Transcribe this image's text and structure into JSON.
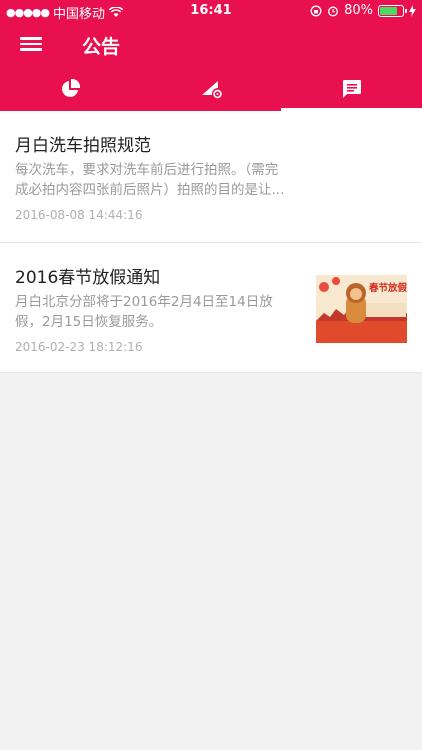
{
  "status_bar": {
    "carrier": "中国移动",
    "time": "16:41",
    "battery": "80%",
    "battery_level": 0.8
  },
  "header": {
    "title": "公告"
  },
  "tabs": [
    {
      "icon": "pie-chart-icon",
      "active": false
    },
    {
      "icon": "signal-settings-icon",
      "active": false
    },
    {
      "icon": "message-icon",
      "active": true
    }
  ],
  "announcements": [
    {
      "title": "月白洗车拍照规范",
      "summary_line1": "每次洗车，要求对洗车前后进行拍照。（需完",
      "summary_line2": "成必拍内容四张前后照片）拍照的目的是让...",
      "date": "2016-08-08 14:44:16"
    },
    {
      "title": "2016春节放假通知",
      "summary_line1": "月白北京分部将于2016年2月4日至14日放",
      "summary_line2": "假，2月15日恢复服务。",
      "date": "2016-02-23 18:12:16",
      "thumbnail_title": "春节放假通"
    }
  ]
}
